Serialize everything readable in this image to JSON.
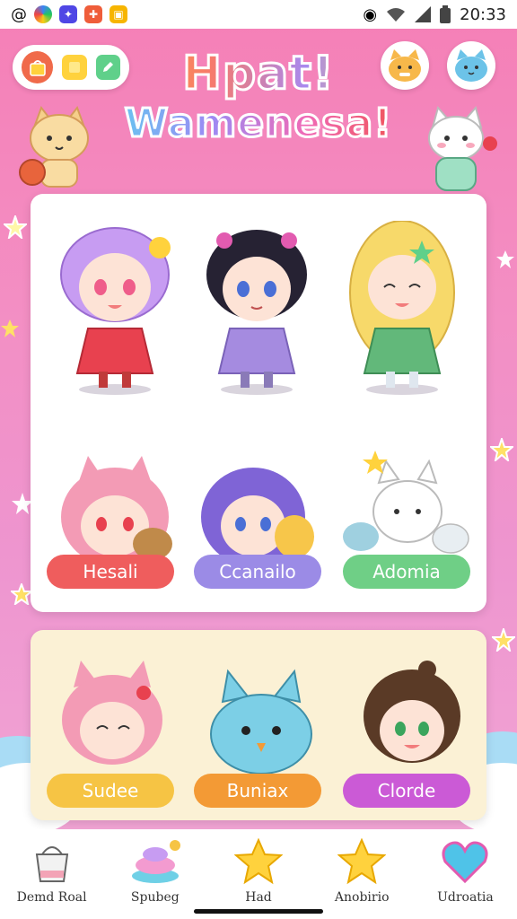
{
  "status_bar": {
    "time": "20:33",
    "icons": [
      "threads-icon",
      "photos-icon",
      "game-app-icon",
      "game-app-icon-2",
      "game-app-icon-3"
    ]
  },
  "header": {
    "title_line1": "Hpat!",
    "title_line2": "Wamenesa!",
    "toolbar": [
      "shop-bag-icon",
      "note-icon",
      "edit-icon"
    ]
  },
  "characters": [
    {
      "name": "",
      "hair": "#c79cf2",
      "outfit": "#e8414f"
    },
    {
      "name": "",
      "hair": "#262233",
      "outfit": "#a58be0"
    },
    {
      "name": "",
      "hair": "#f7d96a",
      "outfit": "#62b87a"
    },
    {
      "name": "Hesali",
      "hair": "#f39bb5",
      "label_color": "#ef5d5d"
    },
    {
      "name": "Ccanailo",
      "hair": "#7f64d6",
      "label_color": "#9b8be6"
    },
    {
      "name": "Adomia",
      "hair": "#ffffff",
      "label_color": "#6fcf86"
    }
  ],
  "secondary": [
    {
      "name": "Sudee",
      "label_color": "#f6c444"
    },
    {
      "name": "Buniax",
      "label_color": "#f39a35"
    },
    {
      "name": "Clorde",
      "label_color": "#cb5ad6"
    }
  ],
  "nav": [
    {
      "label": "Demd Roal",
      "icon": "basket-icon"
    },
    {
      "label": "Spubeg",
      "icon": "cupcake-icon"
    },
    {
      "label": "Had",
      "icon": "star-icon"
    },
    {
      "label": "Anobirio",
      "icon": "star-icon"
    },
    {
      "label": "Udroatia",
      "icon": "heart-icon"
    }
  ]
}
